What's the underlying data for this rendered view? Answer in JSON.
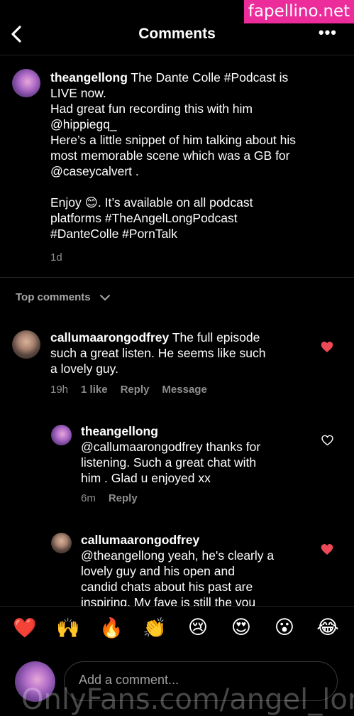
{
  "watermark_top": "fapellino.net",
  "watermark_bottom": "OnlyFans.com/angel_long",
  "header": {
    "title": "Comments",
    "more": "•••"
  },
  "post": {
    "username": "theangellong",
    "line1_rest": " The Dante Colle #Podcast is",
    "line2": "LIVE now.",
    "line3": "Had great fun recording this with him",
    "line4": "@hippiegq_",
    "line5": "Here’s a little snippet of him talking about his",
    "line6": "most memorable scene which was a GB for",
    "line7": "@caseycalvert .",
    "line8": "Enjoy 😊. It’s available on all podcast",
    "line9": "platforms #TheAngelLongPodcast",
    "line10": "#DanteColle #PornTalk",
    "time": "1d"
  },
  "top_comments_label": "Top comments",
  "comments": [
    {
      "username": "callumaarongodfrey",
      "line1_rest": " The full episode",
      "line2": "such a great listen. He seems like such",
      "line3": "a lovely guy.",
      "time": "19h",
      "likes": "1 like",
      "reply": "Reply",
      "message": "Message",
      "liked": true
    },
    {
      "username": "theangellong",
      "line1": "@callumaarongodfrey thanks for",
      "line2": "listening. Such a great chat with",
      "line3": "him . Glad u enjoyed xx",
      "time": "6m",
      "reply": "Reply",
      "liked": false
    },
    {
      "username": "callumaarongodfrey",
      "line1": "@theangellong yeah, he's clearly a",
      "line2": "lovely guy and his open and",
      "line3": "candid chats about his past are",
      "line4": "inspiring. My fave is still the you",
      "liked": true
    }
  ],
  "emojis": [
    "❤️",
    "🙌",
    "🔥",
    "👏",
    "😢",
    "😍",
    "😮",
    "😂"
  ],
  "composer": {
    "placeholder": "Add a comment..."
  },
  "colors": {
    "like_red": "#ed4956",
    "watermark_pink": "#ec2c9a"
  }
}
